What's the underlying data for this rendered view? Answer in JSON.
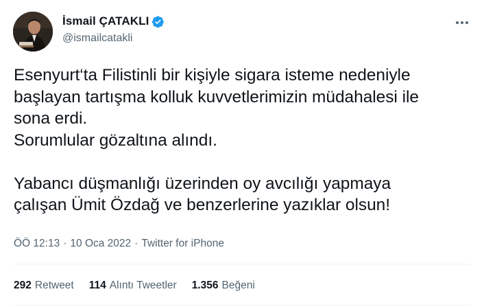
{
  "author": {
    "display_name": "İsmail ÇATAKLI",
    "handle": "@ismailcatakli",
    "verified_icon": "verified-badge-icon",
    "verified_color": "#1d9bf0"
  },
  "tweet": {
    "text": "Esenyurt‘ta Filistinli bir kişiyle sigara isteme nedeniyle\nbaşlayan tartışma kolluk kuvvetlerimizin müdahalesi ile\nsona erdi.\nSorumlular gözaltına alındı.\n\nYabancı düşmanlığı üzerinden oy avcılığı yapmaya\nçalışan Ümit Özdağ ve benzerlerine yazıklar olsun!",
    "time": "ÖÖ 12:13",
    "separator1": "·",
    "date": "10 Oca 2022",
    "separator2": "·",
    "source": "Twitter for iPhone"
  },
  "stats": {
    "retweets_count": "292",
    "retweets_label": "Retweet",
    "quotes_count": "114",
    "quotes_label": "Alıntı Tweetler",
    "likes_count": "1.356",
    "likes_label": "Beğeni"
  },
  "icons": {
    "more": "more-options-icon"
  }
}
